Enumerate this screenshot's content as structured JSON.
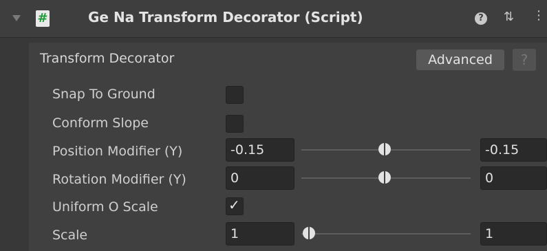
{
  "header": {
    "foldout_icon": "triangle-down-icon",
    "script_icon_glyph": "#",
    "title": "Ge Na Transform Decorator (Script)",
    "help_glyph": "?",
    "preset_glyph": "⇅",
    "menu_glyph": "⋮"
  },
  "section": {
    "title": "Transform Decorator",
    "advanced_label": "Advanced",
    "help_label": "?"
  },
  "fields": {
    "snap_to_ground": {
      "label": "Snap To Ground",
      "checked": false
    },
    "conform_slope": {
      "label": "Conform Slope",
      "checked": false
    },
    "position_modifier": {
      "label": "Position Modifier (Y)",
      "min": "-0.15",
      "max": "-0.15"
    },
    "rotation_modifier": {
      "label": "Rotation Modifier (Y)",
      "min": "0",
      "max": "0"
    },
    "uniform_scale": {
      "label": "Uniform O Scale",
      "checked": true,
      "check_glyph": "✓"
    },
    "scale": {
      "label": "Scale",
      "min": "1",
      "max": "1"
    }
  }
}
